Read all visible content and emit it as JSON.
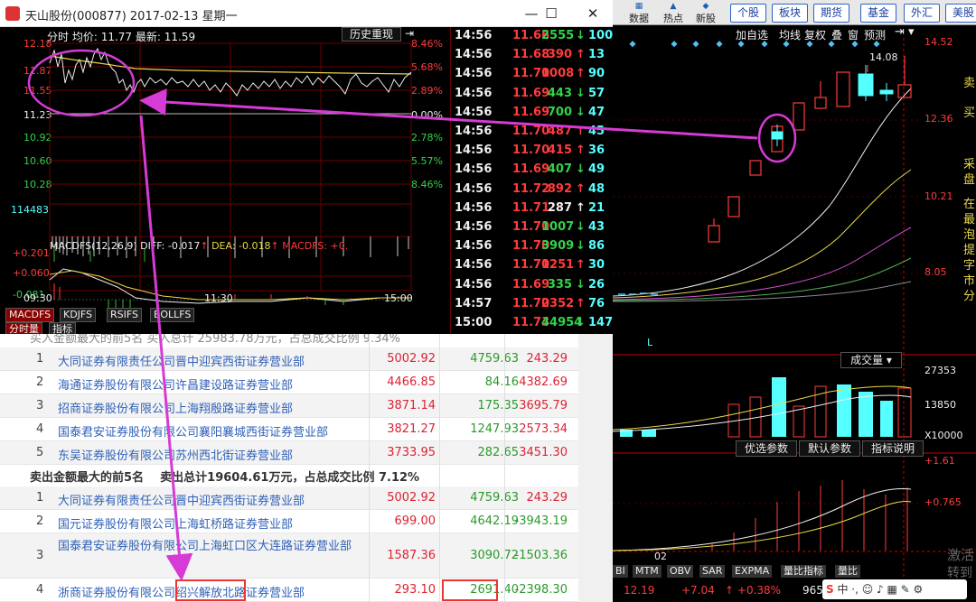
{
  "window": {
    "title": "天山股份(000877) 2017-02-13 星期一",
    "minimize": "—",
    "maximize": "☐",
    "close": "✕"
  },
  "right_toolbar": {
    "icons": [
      "数据",
      "热点",
      "新股"
    ],
    "tabs": [
      "个股",
      "板块",
      "期货",
      "基金",
      "外汇",
      "美股"
    ]
  },
  "intraday": {
    "header_label": "分时",
    "avg_label": "均价: 11.77",
    "latest_label": "最新: 11.59",
    "history_button": "历史重现",
    "price_ticks": [
      "12.18",
      "11.87",
      "11.55",
      "11.23",
      "10.92",
      "10.60",
      "10.28"
    ],
    "pct_ticks": [
      "8.46%",
      "5.68%",
      "2.89%",
      "0.00%",
      "2.78%",
      "5.57%",
      "8.46%"
    ],
    "volume_label": "114483",
    "macd_header": "MACDFS(12,26,9)",
    "diff_label": "DIFF: -0.017",
    "dea_label": "DEA: -0.018",
    "macdfs_label": "MACDFS: +0.",
    "macd_ticks": [
      "+0.201",
      "+0.060",
      "-0.081"
    ],
    "time_ticks": [
      "09:30",
      "11:30",
      "15:00"
    ],
    "indicator_tabs": [
      "MACDFS",
      "KDJFS",
      "RSIFS",
      "BOLLFS"
    ],
    "mode_tabs": [
      "分时量",
      "指标"
    ]
  },
  "ticks": [
    {
      "time": "14:56",
      "price": "11.66",
      "vol": "2555",
      "dir": "down",
      "n": "100"
    },
    {
      "time": "14:56",
      "price": "11.68",
      "vol": "390",
      "dir": "up",
      "n": "13"
    },
    {
      "time": "14:56",
      "price": "11.70",
      "vol": "1008",
      "dir": "up",
      "n": "90"
    },
    {
      "time": "14:56",
      "price": "11.69",
      "vol": "443",
      "dir": "down",
      "n": "57"
    },
    {
      "time": "14:56",
      "price": "11.69",
      "vol": "700",
      "dir": "down",
      "n": "47"
    },
    {
      "time": "14:56",
      "price": "11.70",
      "vol": "487",
      "dir": "up",
      "n": "45"
    },
    {
      "time": "14:56",
      "price": "11.70",
      "vol": "415",
      "dir": "up",
      "n": "36"
    },
    {
      "time": "14:56",
      "price": "11.69",
      "vol": "407",
      "dir": "down",
      "n": "49"
    },
    {
      "time": "14:56",
      "price": "11.72",
      "vol": "892",
      "dir": "up",
      "n": "48"
    },
    {
      "time": "14:56",
      "price": "11.71",
      "vol": "287",
      "dir": "flat",
      "n": "21"
    },
    {
      "time": "14:56",
      "price": "11.70",
      "vol": "1007",
      "dir": "down",
      "n": "43"
    },
    {
      "time": "14:56",
      "price": "11.70",
      "vol": "3909",
      "dir": "down",
      "n": "86"
    },
    {
      "time": "14:56",
      "price": "11.70",
      "vol": "1251",
      "dir": "up",
      "n": "30"
    },
    {
      "time": "14:56",
      "price": "11.69",
      "vol": "335",
      "dir": "down",
      "n": "26"
    },
    {
      "time": "14:57",
      "price": "11.70",
      "vol": "2352",
      "dir": "up",
      "n": "76"
    },
    {
      "time": "15:00",
      "price": "11.73",
      "vol": "44954",
      "dir": "down",
      "n": "1474"
    }
  ],
  "kline": {
    "tabs": [
      "加自选",
      "均线",
      "复权",
      "叠",
      "窗",
      "预测"
    ],
    "price_ticks": [
      "14.52",
      "12.36",
      "10.21",
      "8.05"
    ],
    "peak_label": "14.08",
    "low_marker": "L",
    "vol_selector": "成交量",
    "vol_ticks": [
      "27353",
      "13850",
      "X10000"
    ],
    "param_buttons": [
      "优选参数",
      "默认参数",
      "指标说明"
    ],
    "macd_ticks": [
      "+1.61",
      "+0.765"
    ],
    "month_label": "02",
    "bottom_tabs": [
      "BI",
      "MTM",
      "OBV",
      "SAR",
      "EXPMA",
      "量比指标",
      "量比"
    ],
    "status_left": "12.19",
    "status_mid": "+7.04",
    "status_pct": "+0.38%",
    "status_right": "965",
    "watermark1": "激活",
    "watermark2": "转到",
    "side_chars": [
      "卖",
      "买",
      "采",
      "盘",
      "在",
      "最",
      "泡",
      "提",
      "字",
      "市",
      "分"
    ]
  },
  "table": {
    "top_partial": "买入金额最大的前5名  买入总计 25983.78万元，占总成交比例 9.34%",
    "buy_rows": [
      {
        "idx": "1",
        "name": "大同证券有限责任公司晋中迎宾西街证券营业部",
        "v1": "5002.92",
        "v2": "4759.63",
        "v3": "243.29"
      },
      {
        "idx": "2",
        "name": "海通证券股份有限公司许昌建设路证券营业部",
        "v1": "4466.85",
        "v2": "84.16",
        "v3": "4382.69"
      },
      {
        "idx": "3",
        "name": "招商证券股份有限公司上海翔殷路证券营业部",
        "v1": "3871.14",
        "v2": "175.35",
        "v3": "3695.79"
      },
      {
        "idx": "4",
        "name": "国泰君安证券股份有限公司襄阳襄城西街证券营业部",
        "v1": "3821.27",
        "v2": "1247.93",
        "v3": "2573.34"
      },
      {
        "idx": "5",
        "name": "东吴证券股份有限公司苏州西北街证券营业部",
        "v1": "3733.95",
        "v2": "282.65",
        "v3": "3451.30"
      }
    ],
    "sell_title_a": "卖出金额最大的前5名",
    "sell_title_b": "卖出总计",
    "sell_total": "19604.61",
    "sell_title_c": "万元，占总成交比例",
    "sell_pct": "7.12%",
    "sell_rows": [
      {
        "idx": "1",
        "name": "大同证券有限责任公司晋中迎宾西街证券营业部",
        "v1": "5002.92",
        "v2": "4759.63",
        "v3": "243.29"
      },
      {
        "idx": "2",
        "name": "国元证券股份有限公司上海虹桥路证券营业部",
        "v1": "699.00",
        "v2": "4642.19",
        "v3": "-3943.19"
      },
      {
        "idx": "3",
        "name": "国泰君安证券股份有限公司上海虹口区大连路证券营业部",
        "v1": "1587.36",
        "v2": "3090.72",
        "v3": "-1503.36"
      },
      {
        "idx": "4",
        "name": "浙商证券股份有限公司绍兴解放北路证券营业部",
        "v1": "293.10",
        "v2": "2691.40",
        "v3": "-2398.30"
      }
    ]
  },
  "colors": {
    "up": "#ff3b3b",
    "down": "#32d24a",
    "annotation": "#d63bd6",
    "tab_blue": "#1a3fa0"
  }
}
